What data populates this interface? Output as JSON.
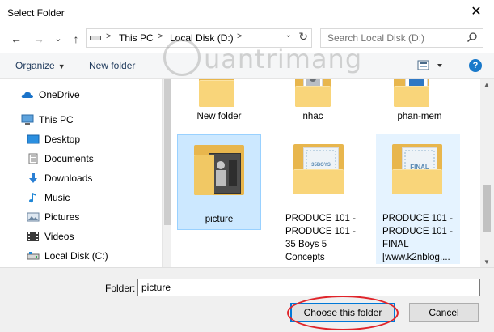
{
  "window": {
    "title": "Select Folder",
    "close_glyph": "✕"
  },
  "nav": {
    "back_glyph": "←",
    "forward_glyph": "→",
    "recent_glyph": "⌄",
    "up_glyph": "↑",
    "breadcrumbs": [
      "This PC",
      "Local Disk (D:)"
    ],
    "separator": ">",
    "dropdown_glyph": "⌄",
    "refresh_glyph": "↻",
    "search_placeholder": "Search Local Disk (D:)"
  },
  "toolbar": {
    "organize": "Organize",
    "new_folder": "New folder",
    "help": "?"
  },
  "sidebar": {
    "items": [
      {
        "label": "OneDrive",
        "icon": "onedrive-icon"
      },
      {
        "label": "This PC",
        "icon": "computer-icon"
      },
      {
        "label": "Desktop",
        "icon": "desktop-icon"
      },
      {
        "label": "Documents",
        "icon": "documents-icon"
      },
      {
        "label": "Downloads",
        "icon": "downloads-icon"
      },
      {
        "label": "Music",
        "icon": "music-icon"
      },
      {
        "label": "Pictures",
        "icon": "pictures-icon"
      },
      {
        "label": "Videos",
        "icon": "videos-icon"
      },
      {
        "label": "Local Disk (C:)",
        "icon": "drive-icon"
      }
    ]
  },
  "files": [
    {
      "label": "New folder"
    },
    {
      "label": "nhac"
    },
    {
      "label": "phan-mem"
    },
    {
      "label": "picture",
      "selected": true
    },
    {
      "label": "PRODUCE 101 - PRODUCE 101 - 35 Boys 5 Concepts",
      "lines": [
        "PRODUCE 101 -",
        "PRODUCE 101 -",
        "35 Boys 5",
        "Concepts"
      ]
    },
    {
      "label": "PRODUCE 101 - PRODUCE 101 - FINAL [www.k2nblog....",
      "lines": [
        "PRODUCE 101 -",
        "PRODUCE 101 -",
        "FINAL",
        "[www.k2nblog...."
      ]
    }
  ],
  "bottom": {
    "folder_label": "Folder:",
    "folder_value": "picture",
    "choose_button": "Choose this folder",
    "cancel_button": "Cancel"
  },
  "watermark": {
    "text": "uantrimang"
  },
  "colors": {
    "accent": "#0078d7",
    "selection": "#cce8ff",
    "highlight_ellipse": "#e0242a"
  }
}
